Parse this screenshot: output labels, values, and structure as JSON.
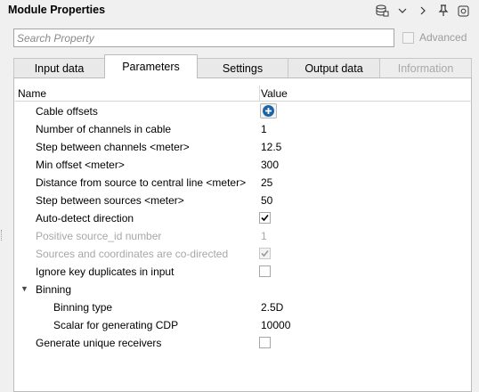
{
  "window": {
    "title": "Module Properties"
  },
  "toolbar": {
    "icons": [
      {
        "name": "database-icon",
        "glyph": "⛁"
      },
      {
        "name": "chevron-down-icon",
        "glyph": "∨"
      },
      {
        "name": "chevron-right-icon",
        "glyph": ">"
      },
      {
        "name": "pin-icon",
        "glyph": "📌"
      },
      {
        "name": "settings-icon",
        "glyph": "⚙"
      }
    ]
  },
  "search": {
    "placeholder": "Search Property"
  },
  "advanced": {
    "label": "Advanced",
    "checked": false,
    "enabled": false
  },
  "tabs": [
    {
      "label": "Input data",
      "active": false,
      "enabled": true
    },
    {
      "label": "Parameters",
      "active": true,
      "enabled": true
    },
    {
      "label": "Settings",
      "active": false,
      "enabled": true
    },
    {
      "label": "Output data",
      "active": false,
      "enabled": true
    },
    {
      "label": "Information",
      "active": false,
      "enabled": false
    }
  ],
  "grid": {
    "headers": {
      "name": "Name",
      "value": "Value"
    },
    "rows": [
      {
        "name": "Cable offsets",
        "type": "add-button"
      },
      {
        "name": "Number of channels in cable",
        "value": "1"
      },
      {
        "name": "Step between channels <meter>",
        "value": "12.5"
      },
      {
        "name": "Min offset <meter>",
        "value": "300"
      },
      {
        "name": "Distance from source to central line <meter>",
        "value": "25"
      },
      {
        "name": "Step between sources <meter>",
        "value": "50"
      },
      {
        "name": "Auto-detect direction",
        "type": "checkbox",
        "checked": true
      },
      {
        "name": "Positive source_id number",
        "value": "1",
        "disabled": true
      },
      {
        "name": "Sources and coordinates are co-directed",
        "type": "checkbox",
        "checked": true,
        "disabled": true
      },
      {
        "name": "Ignore key duplicates in input",
        "type": "checkbox",
        "checked": false
      },
      {
        "name": "Binning",
        "type": "group",
        "expanded": true
      },
      {
        "name": "Binning type",
        "value": "2.5D",
        "child": true
      },
      {
        "name": "Scalar for generating CDP",
        "value": "10000",
        "child": true
      },
      {
        "name": "Generate unique receivers",
        "type": "checkbox",
        "checked": false
      }
    ]
  },
  "colors": {
    "accent": "#1c63a8",
    "border": "#bcbcbc",
    "disabled_text": "#a7a7a7"
  }
}
